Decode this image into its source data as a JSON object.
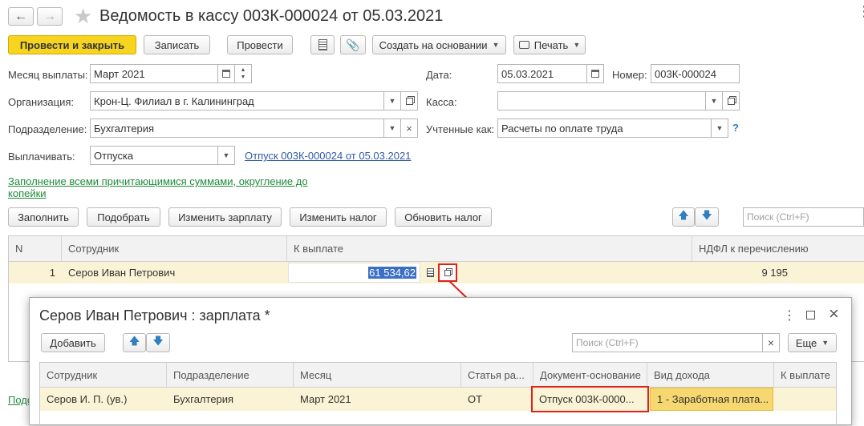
{
  "window": {
    "title": "Ведомость в кассу 003К-000024 от 05.03.2021"
  },
  "toolbar": {
    "post_close": "Провести и закрыть",
    "save": "Записать",
    "post": "Провести",
    "create_based": "Создать на основании",
    "print": "Печать"
  },
  "form": {
    "month_label": "Месяц выплаты:",
    "month_value": "Март 2021",
    "date_label": "Дата:",
    "date_value": "05.03.2021",
    "number_label": "Номер:",
    "number_value": "003К-000024",
    "org_label": "Организация:",
    "org_value": "Крон-Ц. Филиал в г. Калининград",
    "kassa_label": "Касса:",
    "kassa_value": "",
    "dept_label": "Подразделение:",
    "dept_value": "Бухгалтерия",
    "accounted_label": "Учтенные как:",
    "accounted_value": "Расчеты по оплате труда",
    "help": "?",
    "pay_label": "Выплачивать:",
    "pay_value": "Отпуска",
    "pay_link": "Отпуск 003К-000024 от 05.03.2021",
    "fill_note": "Заполнение всеми причитающимися суммами, округление до копейки"
  },
  "actions": {
    "fill": "Заполнить",
    "pick": "Подобрать",
    "change_salary": "Изменить зарплату",
    "change_tax": "Изменить налог",
    "update_tax": "Обновить налог",
    "search_placeholder": "Поиск (Ctrl+F)"
  },
  "main_table": {
    "columns": [
      "N",
      "Сотрудник",
      "К выплате",
      "НДФЛ к перечислению"
    ],
    "rows": [
      {
        "n": "1",
        "employee": "Серов Иван Петрович",
        "amount": "61 534,62",
        "ndfl": "9 195"
      }
    ]
  },
  "bottom_link_partial": "Подо",
  "dialog": {
    "title": "Серов Иван Петрович : зарплата *",
    "add": "Добавить",
    "search_placeholder": "Поиск (Ctrl+F)",
    "search_clear": "×",
    "more": "Еще",
    "columns": [
      "Сотрудник",
      "Подразделение",
      "Месяц",
      "Статья ра...",
      "Документ-основание",
      "Вид дохода",
      "К выплате"
    ],
    "rows": [
      {
        "employee": "Серов И. П. (ув.)",
        "dept": "Бухгалтерия",
        "month": "Март 2021",
        "article": "ОТ",
        "doc": "Отпуск 003К-0000...",
        "income": "1 - Заработная плата...",
        "amount": ""
      }
    ]
  },
  "colors": {
    "accent_yellow": "#f7d41f",
    "row_highlight": "#fbf3d5",
    "annotation_red": "#e0201b",
    "link_blue": "#2f59a8",
    "link_green": "#1f8a3a"
  }
}
